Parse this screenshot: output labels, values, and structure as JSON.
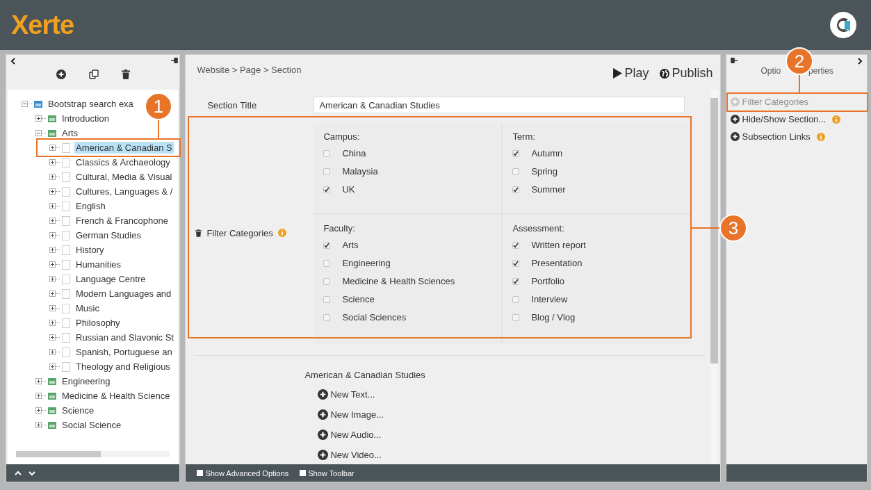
{
  "header": {
    "logo": "Xerte"
  },
  "left_panel": {
    "tree": [
      {
        "label": "Bootstrap search exa",
        "kind": "project",
        "expanded": true,
        "selected": false,
        "children": [
          {
            "label": "Introduction",
            "kind": "page",
            "expanded": false,
            "selected": false
          },
          {
            "label": "Arts",
            "kind": "page",
            "expanded": true,
            "selected": false,
            "children": [
              {
                "label": "American & Canadian S",
                "kind": "section",
                "expanded": false,
                "selected": true
              },
              {
                "label": "Classics & Archaeology",
                "kind": "section",
                "expanded": false,
                "selected": false
              },
              {
                "label": "Cultural, Media & Visual",
                "kind": "section",
                "expanded": false,
                "selected": false
              },
              {
                "label": "Cultures, Languages & /",
                "kind": "section",
                "expanded": false,
                "selected": false
              },
              {
                "label": "English",
                "kind": "section",
                "expanded": false,
                "selected": false
              },
              {
                "label": "French & Francophone",
                "kind": "section",
                "expanded": false,
                "selected": false
              },
              {
                "label": "German Studies",
                "kind": "section",
                "expanded": false,
                "selected": false
              },
              {
                "label": "History",
                "kind": "section",
                "expanded": false,
                "selected": false
              },
              {
                "label": "Humanities",
                "kind": "section",
                "expanded": false,
                "selected": false
              },
              {
                "label": "Language Centre",
                "kind": "section",
                "expanded": false,
                "selected": false
              },
              {
                "label": "Modern Languages and",
                "kind": "section",
                "expanded": false,
                "selected": false
              },
              {
                "label": "Music",
                "kind": "section",
                "expanded": false,
                "selected": false
              },
              {
                "label": "Philosophy",
                "kind": "section",
                "expanded": false,
                "selected": false
              },
              {
                "label": "Russian and Slavonic St",
                "kind": "section",
                "expanded": false,
                "selected": false
              },
              {
                "label": "Spanish, Portuguese an",
                "kind": "section",
                "expanded": false,
                "selected": false
              },
              {
                "label": "Theology and Religious",
                "kind": "section",
                "expanded": false,
                "selected": false
              }
            ]
          },
          {
            "label": "Engineering",
            "kind": "page",
            "expanded": false,
            "selected": false
          },
          {
            "label": "Medicine & Health Science",
            "kind": "page",
            "expanded": false,
            "selected": false
          },
          {
            "label": "Science",
            "kind": "page",
            "expanded": false,
            "selected": false
          },
          {
            "label": "Social Science",
            "kind": "page",
            "expanded": false,
            "selected": false
          }
        ]
      }
    ]
  },
  "editor": {
    "breadcrumb": "Website > Page > Section",
    "actions": [
      {
        "label": "Play",
        "kind": "play"
      },
      {
        "label": "Publish",
        "kind": "publish"
      }
    ],
    "section_title": {
      "label": "Section Title",
      "value": "American & Canadian Studies"
    },
    "filter": {
      "label": "Filter Categories",
      "groups": [
        {
          "title": "Campus:",
          "options": [
            {
              "label": "China",
              "checked": false
            },
            {
              "label": "Malaysia",
              "checked": false
            },
            {
              "label": "UK",
              "checked": true
            }
          ]
        },
        {
          "title": "Term:",
          "options": [
            {
              "label": "Autumn",
              "checked": true
            },
            {
              "label": "Spring",
              "checked": false
            },
            {
              "label": "Summer",
              "checked": true
            }
          ]
        },
        {
          "title": "Faculty:",
          "options": [
            {
              "label": "Arts",
              "checked": true
            },
            {
              "label": "Engineering",
              "checked": false
            },
            {
              "label": "Medicine & Health Sciences",
              "checked": false
            },
            {
              "label": "Science",
              "checked": false
            },
            {
              "label": "Social Sciences",
              "checked": false
            }
          ]
        },
        {
          "title": "Assessment:",
          "options": [
            {
              "label": "Written report",
              "checked": true
            },
            {
              "label": "Presentation",
              "checked": true
            },
            {
              "label": "Portfolio",
              "checked": true
            },
            {
              "label": "Interview",
              "checked": false
            },
            {
              "label": "Blog / Vlog",
              "checked": false
            }
          ]
        }
      ]
    },
    "preview": {
      "title": "American & Canadian Studies",
      "buttons": [
        "New Text...",
        "New Image...",
        "New Audio...",
        "New Video..."
      ]
    },
    "footer_options": [
      {
        "label": "Show Advanced Options",
        "checked": false
      },
      {
        "label": "Show Toolbar",
        "checked": false
      }
    ]
  },
  "properties": {
    "title_parts": [
      "Optio",
      "perties"
    ],
    "items": [
      {
        "label": "Filter Categories",
        "disabled": true,
        "info": false
      },
      {
        "label": "Hide/Show Section...",
        "disabled": false,
        "info": true
      },
      {
        "label": "Subsection Links",
        "disabled": false,
        "info": true
      }
    ]
  },
  "callouts": [
    {
      "number": "1"
    },
    {
      "number": "2"
    },
    {
      "number": "3"
    }
  ]
}
